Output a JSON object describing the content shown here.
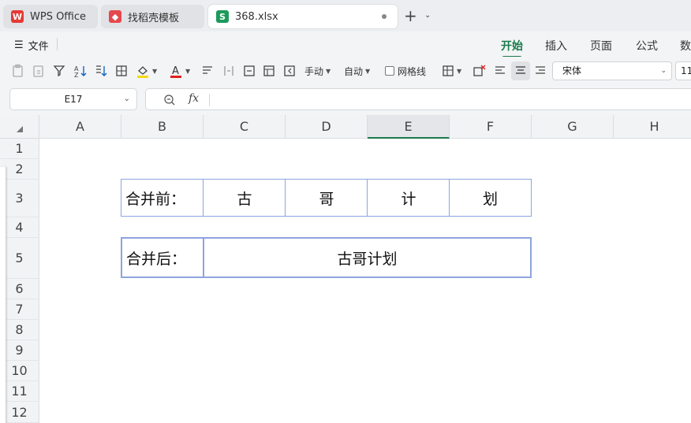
{
  "tabs": [
    {
      "label": "WPS Office",
      "icon": "wps-logo-icon"
    },
    {
      "label": "找稻壳模板",
      "icon": "daoke-logo-icon"
    },
    {
      "label": "368.xlsx",
      "icon": "spreadsheet-icon",
      "icon_letter": "S"
    }
  ],
  "menu": {
    "file_label": "文件",
    "ribbon_tabs": [
      "开始",
      "插入",
      "页面",
      "公式",
      "数"
    ]
  },
  "toolbar": {
    "manual_label": "手动",
    "auto_label": "自动",
    "gridlines_label": "网格线",
    "font_name": "宋体",
    "font_size": "11"
  },
  "formula_bar": {
    "cell_ref": "E17",
    "fx_label": "fx",
    "formula_value": ""
  },
  "sheet": {
    "columns": [
      "A",
      "B",
      "C",
      "D",
      "E",
      "F",
      "G",
      "H"
    ],
    "selected_column": "E",
    "rows": [
      "1",
      "2",
      "3",
      "4",
      "5",
      "6",
      "7",
      "8",
      "9",
      "10",
      "11",
      "12"
    ],
    "before_label": "合并前：",
    "before_chars": [
      "古",
      "哥",
      "计",
      "划"
    ],
    "after_label": "合并后：",
    "after_value": "古哥计划"
  },
  "colors": {
    "accent": "#1a7a4c",
    "cell_border": "#8ea4e0"
  }
}
